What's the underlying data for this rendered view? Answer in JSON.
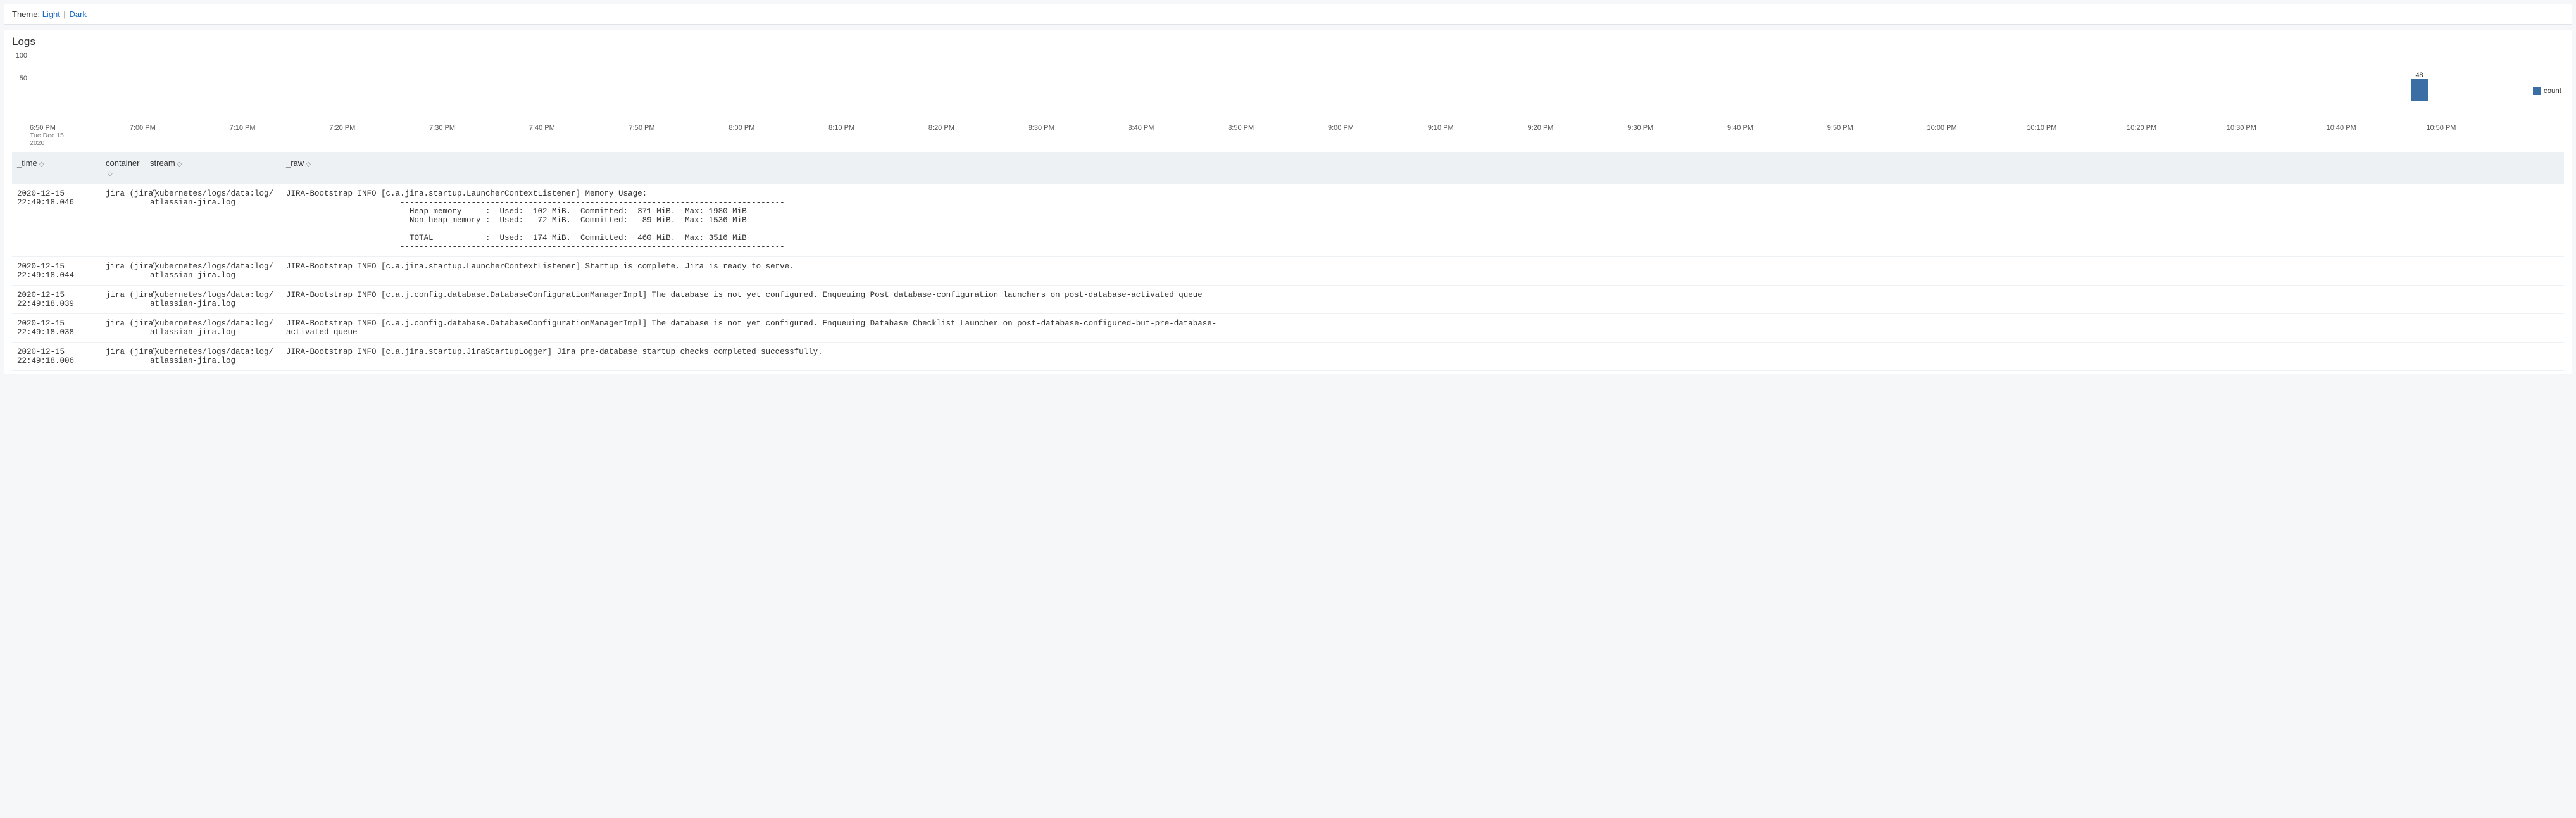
{
  "theme": {
    "label": "Theme:",
    "light": "Light",
    "sep": "|",
    "dark": "Dark"
  },
  "title": "Logs",
  "yticks": [
    "100",
    "50"
  ],
  "legend": "count",
  "xticks": [
    {
      "t": "6:50 PM",
      "sub1": "Tue Dec 15",
      "sub2": "2020"
    },
    {
      "t": "7:00 PM"
    },
    {
      "t": "7:10 PM"
    },
    {
      "t": "7:20 PM"
    },
    {
      "t": "7:30 PM"
    },
    {
      "t": "7:40 PM"
    },
    {
      "t": "7:50 PM"
    },
    {
      "t": "8:00 PM"
    },
    {
      "t": "8:10 PM"
    },
    {
      "t": "8:20 PM"
    },
    {
      "t": "8:30 PM"
    },
    {
      "t": "8:40 PM"
    },
    {
      "t": "8:50 PM"
    },
    {
      "t": "9:00 PM"
    },
    {
      "t": "9:10 PM"
    },
    {
      "t": "9:20 PM"
    },
    {
      "t": "9:30 PM"
    },
    {
      "t": "9:40 PM"
    },
    {
      "t": "9:50 PM"
    },
    {
      "t": "10:00 PM"
    },
    {
      "t": "10:10 PM"
    },
    {
      "t": "10:20 PM"
    },
    {
      "t": "10:30 PM"
    },
    {
      "t": "10:40 PM"
    },
    {
      "t": "10:50 PM"
    }
  ],
  "chart_data": {
    "type": "bar",
    "x_field": "_time",
    "categories": [
      "6:50 PM",
      "7:00 PM",
      "7:10 PM",
      "7:20 PM",
      "7:30 PM",
      "7:40 PM",
      "7:50 PM",
      "8:00 PM",
      "8:10 PM",
      "8:20 PM",
      "8:30 PM",
      "8:40 PM",
      "8:50 PM",
      "9:00 PM",
      "9:10 PM",
      "9:20 PM",
      "9:30 PM",
      "9:40 PM",
      "9:50 PM",
      "10:00 PM",
      "10:10 PM",
      "10:20 PM",
      "10:30 PM",
      "10:40 PM",
      "10:50 PM"
    ],
    "series": [
      {
        "name": "count",
        "values": [
          0,
          0,
          0,
          0,
          0,
          0,
          0,
          0,
          0,
          0,
          0,
          0,
          0,
          0,
          0,
          0,
          0,
          0,
          0,
          0,
          0,
          0,
          0,
          48,
          0
        ]
      }
    ],
    "bar_label": "48",
    "title": "Logs",
    "ylabel": "",
    "xlabel": "",
    "ylim": [
      0,
      100
    ],
    "yticks": [
      50,
      100
    ],
    "date": "Tue Dec 15 2020",
    "legend_position": "right"
  },
  "columns": {
    "time": "_time",
    "container": "container",
    "stream": "stream",
    "raw": "_raw"
  },
  "rows": [
    {
      "time": "2020-12-15\n22:49:18.046",
      "container": "jira (jira)",
      "stream": "/kubernetes/logs/data:log/atlassian-jira.log",
      "prefix": "JIRA-Bootstrap INFO     ",
      "body": "[c.a.jira.startup.LauncherContextListener] Memory Usage:\n    ---------------------------------------------------------------------------------\n      Heap memory     :  Used:  102 MiB.  Committed:  371 MiB.  Max: 1980 MiB\n      Non-heap memory :  Used:   72 MiB.  Committed:   89 MiB.  Max: 1536 MiB\n    ---------------------------------------------------------------------------------\n      TOTAL           :  Used:  174 MiB.  Committed:  460 MiB.  Max: 3516 MiB\n    ---------------------------------------------------------------------------------"
    },
    {
      "time": "2020-12-15\n22:49:18.044",
      "container": "jira (jira)",
      "stream": "/kubernetes/logs/data:log/atlassian-jira.log",
      "prefix": "JIRA-Bootstrap INFO     ",
      "body": "[c.a.jira.startup.LauncherContextListener] Startup is complete. Jira is ready to serve."
    },
    {
      "time": "2020-12-15\n22:49:18.039",
      "container": "jira (jira)",
      "stream": "/kubernetes/logs/data:log/atlassian-jira.log",
      "prefix": "JIRA-Bootstrap INFO     ",
      "body": "[c.a.j.config.database.DatabaseConfigurationManagerImpl] The database is not yet configured. Enqueuing Post database-configuration launchers on post-database-activated queue"
    },
    {
      "time": "2020-12-15\n22:49:18.038",
      "container": "jira (jira)",
      "stream": "/kubernetes/logs/data:log/atlassian-jira.log",
      "prefix": "JIRA-Bootstrap INFO\nactivated queue",
      "body": "[c.a.j.config.database.DatabaseConfigurationManagerImpl] The database is not yet configured. Enqueuing Database Checklist Launcher on post-database-configured-but-pre-database-"
    },
    {
      "time": "2020-12-15\n22:49:18.006",
      "container": "jira (jira)",
      "stream": "/kubernetes/logs/data:log/atlassian-jira.log",
      "prefix": "JIRA-Bootstrap INFO     ",
      "body": "[c.a.jira.startup.JiraStartupLogger] Jira pre-database startup checks completed successfully."
    }
  ]
}
